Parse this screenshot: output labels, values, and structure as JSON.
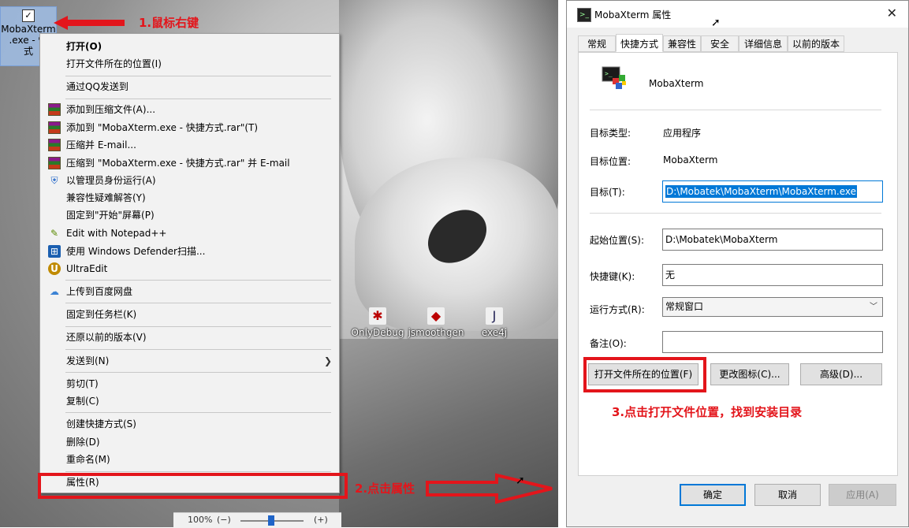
{
  "desktop": {
    "selected_icon": {
      "label_line1": "MobaXterm",
      "label_line2": ".exe - 快",
      "label_line3": "式"
    },
    "icons": [
      {
        "name": "OnlyDebug",
        "glyph": "✱"
      },
      {
        "name": "jsmoothgen",
        "glyph": "◆"
      },
      {
        "name": "exe4j",
        "glyph": "J"
      }
    ]
  },
  "context_menu": {
    "items": [
      {
        "label": "打开(O)",
        "bold": true
      },
      {
        "label": "打开文件所在的位置(I)"
      },
      {
        "label": "通过QQ发送到"
      },
      {
        "label": "添加到压缩文件(A)...",
        "icon": "winrar-icon"
      },
      {
        "label": "添加到 \"MobaXterm.exe - 快捷方式.rar\"(T)",
        "icon": "winrar-icon"
      },
      {
        "label": "压缩并 E-mail...",
        "icon": "winrar-icon"
      },
      {
        "label": "压缩到 \"MobaXterm.exe - 快捷方式.rar\" 并 E-mail",
        "icon": "winrar-icon"
      },
      {
        "label": "以管理员身份运行(A)",
        "icon": "shield-icon"
      },
      {
        "label": "兼容性疑难解答(Y)"
      },
      {
        "label": "固定到\"开始\"屏幕(P)"
      },
      {
        "label": "Edit with Notepad++",
        "icon": "notepad-icon"
      },
      {
        "label": "使用 Windows Defender扫描...",
        "icon": "defender-icon"
      },
      {
        "label": "UltraEdit",
        "icon": "ultraedit-icon"
      },
      {
        "label": "上传到百度网盘",
        "icon": "baidu-cloud-icon"
      },
      {
        "label": "固定到任务栏(K)"
      },
      {
        "label": "还原以前的版本(V)"
      },
      {
        "label": "发送到(N)",
        "submenu": true
      },
      {
        "label": "剪切(T)"
      },
      {
        "label": "复制(C)"
      },
      {
        "label": "创建快捷方式(S)"
      },
      {
        "label": "删除(D)"
      },
      {
        "label": "重命名(M)"
      },
      {
        "label": "属性(R)"
      }
    ]
  },
  "annotations": {
    "step1": "1.鼠标右键",
    "step2": "2.点击属性",
    "step3": "3.点击打开文件位置，找到安装目录"
  },
  "dialog": {
    "title": "MobaXterm 属性",
    "close": "✕",
    "tabs": [
      "常规",
      "快捷方式",
      "兼容性",
      "安全",
      "详细信息",
      "以前的版本"
    ],
    "active_tab": 1,
    "app_name": "MobaXterm",
    "target_type_label": "目标类型:",
    "target_type_value": "应用程序",
    "target_location_label": "目标位置:",
    "target_location_value": "MobaXterm",
    "target_label": "目标(T):",
    "target_value": "D:\\Mobatek\\MobaXterm\\MobaXterm.exe",
    "start_in_label": "起始位置(S):",
    "start_in_value": "D:\\Mobatek\\MobaXterm",
    "shortcut_key_label": "快捷键(K):",
    "shortcut_key_value": "无",
    "run_label": "运行方式(R):",
    "run_value": "常规窗口",
    "comment_label": "备注(O):",
    "comment_value": "",
    "open_location_button": "打开文件所在的位置(F)",
    "change_icon_button": "更改图标(C)...",
    "advanced_button": "高级(D)...",
    "ok_button": "确定",
    "cancel_button": "取消",
    "apply_button": "应用(A)"
  },
  "statusbar": {
    "zoom": "100%"
  }
}
